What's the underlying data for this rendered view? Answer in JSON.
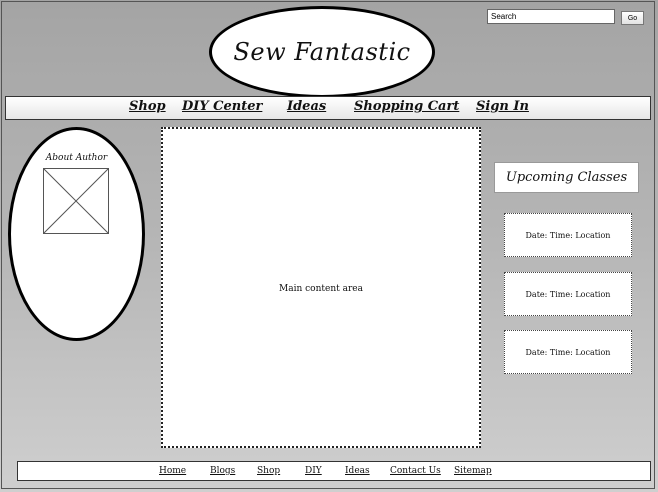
{
  "search": {
    "placeholder": "Search",
    "button_label": "Go"
  },
  "logo": {
    "text": "Sew Fantastic"
  },
  "nav": {
    "items": [
      {
        "label": "Shop"
      },
      {
        "label": "DIY Center"
      },
      {
        "label": "Ideas"
      },
      {
        "label": "Shopping Cart"
      },
      {
        "label": "Sign In"
      }
    ]
  },
  "author": {
    "title": "About Author"
  },
  "main": {
    "label": "Main content area"
  },
  "classes": {
    "title": "Upcoming Classes",
    "items": [
      {
        "text": "Date: Time: Location"
      },
      {
        "text": "Date: Time: Location"
      },
      {
        "text": "Date: Time: Location"
      }
    ]
  },
  "footer": {
    "links": [
      {
        "label": "Home"
      },
      {
        "label": "Blogs"
      },
      {
        "label": "Shop"
      },
      {
        "label": "DIY"
      },
      {
        "label": "Ideas"
      },
      {
        "label": "Contact Us"
      },
      {
        "label": "Sitemap"
      }
    ]
  }
}
